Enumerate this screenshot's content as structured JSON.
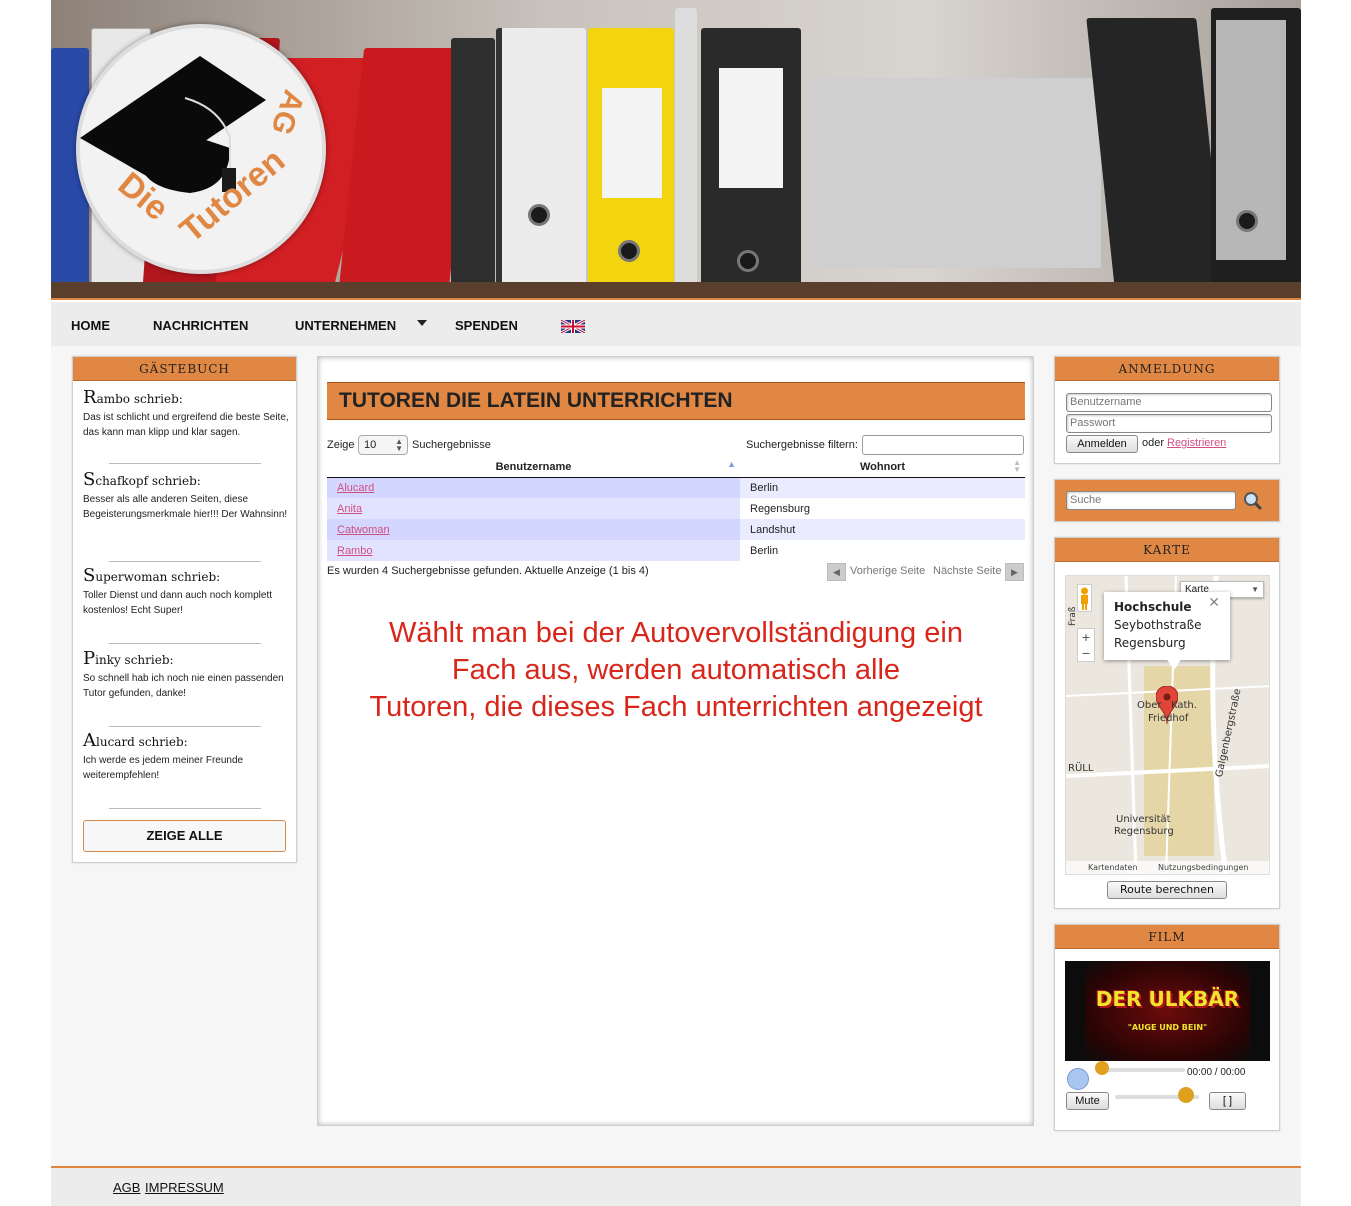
{
  "header": {
    "logo_text": "Die Tutoren AG"
  },
  "nav": {
    "items": [
      "HOME",
      "NACHRICHTEN",
      "UNTERNEHMEN",
      "SPENDEN"
    ],
    "language_icon": "uk-flag-icon"
  },
  "guestbook": {
    "title": "Gästebuch",
    "entries": [
      {
        "initial": "R",
        "rest": "ambo schrieb:",
        "text": "Das ist schlicht und ergreifend die beste Seite, das kann man klipp und klar sagen."
      },
      {
        "initial": "S",
        "rest": "chafkopf schrieb:",
        "text": "Besser als alle anderen Seiten, diese Begeisterungsmerkmale hier!!! Der Wahnsinn!"
      },
      {
        "initial": "S",
        "rest": "uperwoman schrieb:",
        "text": "Toller Dienst und dann auch noch komplett kostenlos! Echt Super!"
      },
      {
        "initial": "P",
        "rest": "inky schrieb:",
        "text": "So schnell hab ich noch nie einen passenden Tutor gefunden, danke!"
      },
      {
        "initial": "A",
        "rest": "lucard schrieb:",
        "text": "Ich werde es jedem meiner Freunde weiterempfehlen!"
      }
    ],
    "show_all": "ZEIGE ALLE"
  },
  "main": {
    "title": "TUTOREN DIE LATEIN UNTERRICHTEN",
    "show_label": "Zeige",
    "page_size": "10",
    "results_label": "Suchergebnisse",
    "filter_label": "Suchergebnisse filtern:",
    "filter_value": "",
    "columns": [
      "Benutzername",
      "Wohnort"
    ],
    "rows": [
      {
        "user": "Alucard",
        "city": "Berlin"
      },
      {
        "user": "Anita",
        "city": "Regensburg"
      },
      {
        "user": "Catwoman",
        "city": "Landshut"
      },
      {
        "user": "Rambo",
        "city": "Berlin"
      }
    ],
    "summary": "Es wurden 4 Suchergebnisse gefunden. Aktuelle Anzeige (1 bis 4)",
    "prev": "Vorherige Seite",
    "next": "Nächste Seite",
    "note_lines": [
      "Wählt man bei der Autovervollständigung ein",
      "Fach aus, werden automatisch alle",
      "Tutoren, die dieses Fach unterrichten angezeigt"
    ]
  },
  "login": {
    "title": "Anmeldung",
    "username_placeholder": "Benutzername",
    "password_placeholder": "Passwort",
    "login_button": "Anmelden",
    "or": "oder",
    "register": "Registrieren"
  },
  "search": {
    "placeholder": "Suche"
  },
  "map": {
    "title": "Karte",
    "type": "Karte",
    "info_title": "Hochschule",
    "info_line1": "Seybothstraße",
    "info_line2": "Regensburg",
    "labels": [
      "Ober",
      "Kath.",
      "Friedhof",
      "Galgenbergstraße",
      "RÜLL",
      "Universität",
      "Regensburg",
      "Fraß"
    ],
    "footer_left": "Kartendaten",
    "footer_right": "Nutzungsbedingungen",
    "route_button": "Route berechnen"
  },
  "film": {
    "title": "Film",
    "poster_title": "DER ULKBÄR",
    "poster_sub": "\"AUGE UND BEIN\"",
    "time": "00:00 / 00:00",
    "mute": "Mute",
    "fullscreen": "[   ]",
    "progress": 0,
    "volume": 0.85
  },
  "footer": {
    "links": [
      "AGB",
      "IMPRESSUM"
    ]
  }
}
